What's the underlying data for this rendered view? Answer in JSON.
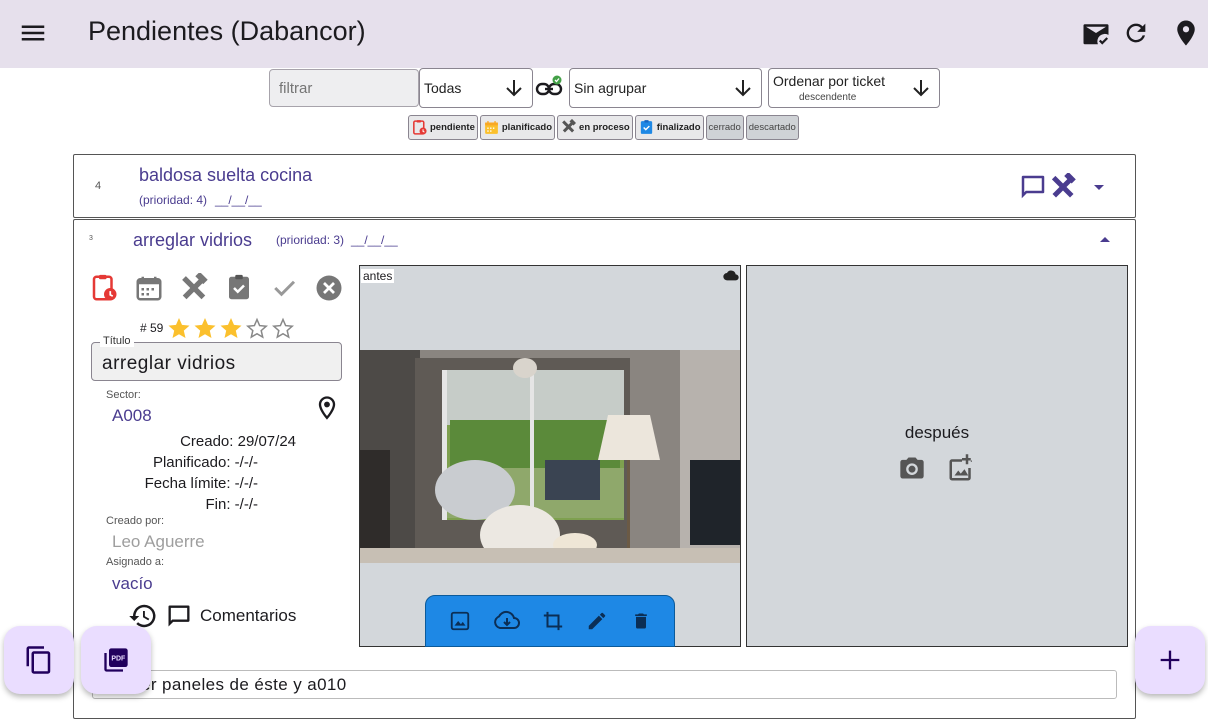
{
  "appbar": {
    "title": "Pendientes (Dabancor)",
    "menu_icon": "menu-icon",
    "actions": [
      "mark-email-read-icon",
      "refresh-icon",
      "location-pin-icon"
    ]
  },
  "toolbar": {
    "filter_placeholder": "filtrar",
    "status_select": "Todas",
    "group_select": "Sin agrupar",
    "order_select": "Ordenar por ticket",
    "order_direction": "descendente"
  },
  "status_chips": [
    {
      "label": "pendiente",
      "icon": "clipboard-clock-icon"
    },
    {
      "label": "planificado",
      "icon": "calendar-icon"
    },
    {
      "label": "en proceso",
      "icon": "tools-icon"
    },
    {
      "label": "finalizado",
      "icon": "clipboard-check-icon"
    },
    {
      "label": "cerrado"
    },
    {
      "label": "descartado"
    }
  ],
  "tickets": [
    {
      "number": "4",
      "title": "baldosa suelta cocina",
      "priority": "(prioridad: 4)",
      "date": "__/__/__"
    },
    {
      "number": "3",
      "title": "arreglar vidrios",
      "priority": "(prioridad: 3)",
      "date": "__/__/__",
      "id_label": "# 59",
      "rating": 3,
      "rating_max": 5,
      "titulo_label": "Título",
      "titulo_value": "arreglar vidrios",
      "sector_label": "Sector:",
      "sector_value": "A008",
      "creado": "Creado: 29/07/24",
      "planificado": "Planificado: -/-/-",
      "fecha_limite": "Fecha límite: -/-/-",
      "fin": "Fin: -/-/-",
      "creado_por_label": "Creado por:",
      "creado_por_value": "Leo Aguerre",
      "asignado_label": "Asignado a:",
      "asignado_value": "vacío",
      "comentarios": "Comentarios",
      "antes_label": "antes",
      "despues_label": "después",
      "description": "er paneles de éste y a010"
    }
  ],
  "colors": {
    "appbar_bg": "#e6e0ec",
    "primary": "#4a3c8f",
    "red": "#e53935",
    "fab_bg": "#eaddff",
    "image_toolbar": "#1e88e5",
    "star": "#fbc02d"
  },
  "fabs": [
    "copy-icon",
    "pdf-icon",
    "add-icon"
  ]
}
